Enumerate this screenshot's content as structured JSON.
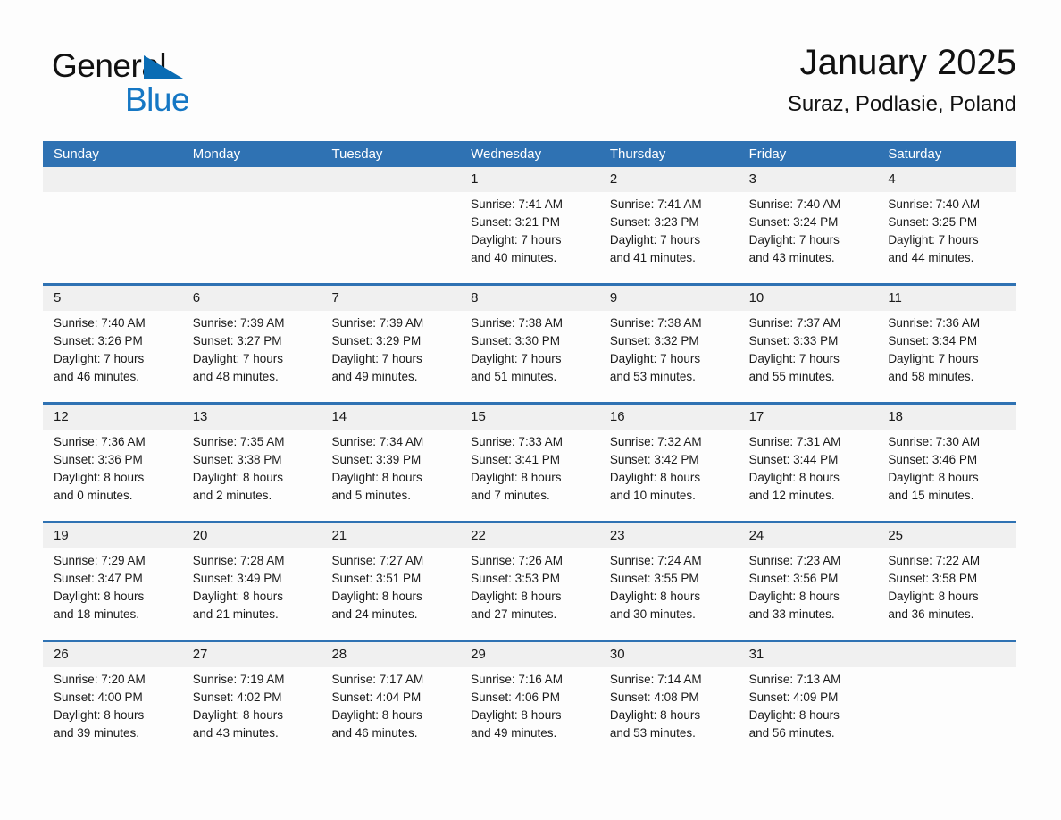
{
  "logo": {
    "word_top": "General",
    "word_bottom": "Blue",
    "triangle_color": "#0a6cb4",
    "blue_text_color": "#1577c4"
  },
  "header": {
    "title": "January 2025",
    "subtitle": "Suraz, Podlasie, Poland"
  },
  "theme": {
    "header_blue": "#2f72b3",
    "date_band_gray": "#f0f0f0",
    "page_background": "#fdfdfd",
    "text_color": "#1a1a1a"
  },
  "weekday_headers": [
    "Sunday",
    "Monday",
    "Tuesday",
    "Wednesday",
    "Thursday",
    "Friday",
    "Saturday"
  ],
  "weeks": [
    {
      "days": [
        {
          "num": "",
          "lines": []
        },
        {
          "num": "",
          "lines": []
        },
        {
          "num": "",
          "lines": []
        },
        {
          "num": "1",
          "lines": [
            "Sunrise: 7:41 AM",
            "Sunset: 3:21 PM",
            "Daylight: 7 hours",
            "and 40 minutes."
          ]
        },
        {
          "num": "2",
          "lines": [
            "Sunrise: 7:41 AM",
            "Sunset: 3:23 PM",
            "Daylight: 7 hours",
            "and 41 minutes."
          ]
        },
        {
          "num": "3",
          "lines": [
            "Sunrise: 7:40 AM",
            "Sunset: 3:24 PM",
            "Daylight: 7 hours",
            "and 43 minutes."
          ]
        },
        {
          "num": "4",
          "lines": [
            "Sunrise: 7:40 AM",
            "Sunset: 3:25 PM",
            "Daylight: 7 hours",
            "and 44 minutes."
          ]
        }
      ]
    },
    {
      "days": [
        {
          "num": "5",
          "lines": [
            "Sunrise: 7:40 AM",
            "Sunset: 3:26 PM",
            "Daylight: 7 hours",
            "and 46 minutes."
          ]
        },
        {
          "num": "6",
          "lines": [
            "Sunrise: 7:39 AM",
            "Sunset: 3:27 PM",
            "Daylight: 7 hours",
            "and 48 minutes."
          ]
        },
        {
          "num": "7",
          "lines": [
            "Sunrise: 7:39 AM",
            "Sunset: 3:29 PM",
            "Daylight: 7 hours",
            "and 49 minutes."
          ]
        },
        {
          "num": "8",
          "lines": [
            "Sunrise: 7:38 AM",
            "Sunset: 3:30 PM",
            "Daylight: 7 hours",
            "and 51 minutes."
          ]
        },
        {
          "num": "9",
          "lines": [
            "Sunrise: 7:38 AM",
            "Sunset: 3:32 PM",
            "Daylight: 7 hours",
            "and 53 minutes."
          ]
        },
        {
          "num": "10",
          "lines": [
            "Sunrise: 7:37 AM",
            "Sunset: 3:33 PM",
            "Daylight: 7 hours",
            "and 55 minutes."
          ]
        },
        {
          "num": "11",
          "lines": [
            "Sunrise: 7:36 AM",
            "Sunset: 3:34 PM",
            "Daylight: 7 hours",
            "and 58 minutes."
          ]
        }
      ]
    },
    {
      "days": [
        {
          "num": "12",
          "lines": [
            "Sunrise: 7:36 AM",
            "Sunset: 3:36 PM",
            "Daylight: 8 hours",
            "and 0 minutes."
          ]
        },
        {
          "num": "13",
          "lines": [
            "Sunrise: 7:35 AM",
            "Sunset: 3:38 PM",
            "Daylight: 8 hours",
            "and 2 minutes."
          ]
        },
        {
          "num": "14",
          "lines": [
            "Sunrise: 7:34 AM",
            "Sunset: 3:39 PM",
            "Daylight: 8 hours",
            "and 5 minutes."
          ]
        },
        {
          "num": "15",
          "lines": [
            "Sunrise: 7:33 AM",
            "Sunset: 3:41 PM",
            "Daylight: 8 hours",
            "and 7 minutes."
          ]
        },
        {
          "num": "16",
          "lines": [
            "Sunrise: 7:32 AM",
            "Sunset: 3:42 PM",
            "Daylight: 8 hours",
            "and 10 minutes."
          ]
        },
        {
          "num": "17",
          "lines": [
            "Sunrise: 7:31 AM",
            "Sunset: 3:44 PM",
            "Daylight: 8 hours",
            "and 12 minutes."
          ]
        },
        {
          "num": "18",
          "lines": [
            "Sunrise: 7:30 AM",
            "Sunset: 3:46 PM",
            "Daylight: 8 hours",
            "and 15 minutes."
          ]
        }
      ]
    },
    {
      "days": [
        {
          "num": "19",
          "lines": [
            "Sunrise: 7:29 AM",
            "Sunset: 3:47 PM",
            "Daylight: 8 hours",
            "and 18 minutes."
          ]
        },
        {
          "num": "20",
          "lines": [
            "Sunrise: 7:28 AM",
            "Sunset: 3:49 PM",
            "Daylight: 8 hours",
            "and 21 minutes."
          ]
        },
        {
          "num": "21",
          "lines": [
            "Sunrise: 7:27 AM",
            "Sunset: 3:51 PM",
            "Daylight: 8 hours",
            "and 24 minutes."
          ]
        },
        {
          "num": "22",
          "lines": [
            "Sunrise: 7:26 AM",
            "Sunset: 3:53 PM",
            "Daylight: 8 hours",
            "and 27 minutes."
          ]
        },
        {
          "num": "23",
          "lines": [
            "Sunrise: 7:24 AM",
            "Sunset: 3:55 PM",
            "Daylight: 8 hours",
            "and 30 minutes."
          ]
        },
        {
          "num": "24",
          "lines": [
            "Sunrise: 7:23 AM",
            "Sunset: 3:56 PM",
            "Daylight: 8 hours",
            "and 33 minutes."
          ]
        },
        {
          "num": "25",
          "lines": [
            "Sunrise: 7:22 AM",
            "Sunset: 3:58 PM",
            "Daylight: 8 hours",
            "and 36 minutes."
          ]
        }
      ]
    },
    {
      "days": [
        {
          "num": "26",
          "lines": [
            "Sunrise: 7:20 AM",
            "Sunset: 4:00 PM",
            "Daylight: 8 hours",
            "and 39 minutes."
          ]
        },
        {
          "num": "27",
          "lines": [
            "Sunrise: 7:19 AM",
            "Sunset: 4:02 PM",
            "Daylight: 8 hours",
            "and 43 minutes."
          ]
        },
        {
          "num": "28",
          "lines": [
            "Sunrise: 7:17 AM",
            "Sunset: 4:04 PM",
            "Daylight: 8 hours",
            "and 46 minutes."
          ]
        },
        {
          "num": "29",
          "lines": [
            "Sunrise: 7:16 AM",
            "Sunset: 4:06 PM",
            "Daylight: 8 hours",
            "and 49 minutes."
          ]
        },
        {
          "num": "30",
          "lines": [
            "Sunrise: 7:14 AM",
            "Sunset: 4:08 PM",
            "Daylight: 8 hours",
            "and 53 minutes."
          ]
        },
        {
          "num": "31",
          "lines": [
            "Sunrise: 7:13 AM",
            "Sunset: 4:09 PM",
            "Daylight: 8 hours",
            "and 56 minutes."
          ]
        },
        {
          "num": "",
          "lines": []
        }
      ]
    }
  ]
}
